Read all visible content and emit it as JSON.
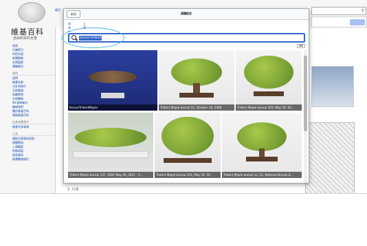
{
  "background": {
    "logo_title": "維基百科",
    "logo_subtitle": "自由的百科全書",
    "top_tab_label": "條目",
    "sidebar": [
      {
        "heading": "",
        "links": [
          "首頁",
          "分類索引",
          "特色內容",
          "新聞動態",
          "近期變更",
          "隨機條目"
        ]
      },
      {
        "heading": "說明",
        "links": [
          "說明",
          "維基社群",
          "方針與指引",
          "互助客棧",
          "知識問答",
          "字詞轉換",
          "IRC即時聊天",
          "聯絡我們",
          "關於維基百科",
          "資助維基百科"
        ]
      },
      {
        "heading": "在其他專案中",
        "links": [
          "維基共享資源"
        ]
      },
      {
        "heading": "工具",
        "links": [
          "連結至頁面的頁面",
          "相關更改",
          "上傳檔案",
          "特殊頁面",
          "頁面資訊",
          "維基數據項目"
        ]
      }
    ],
    "section_text": "2. 川派"
  },
  "dialog": {
    "cancel_label": "取消",
    "title": "媒體設定",
    "tabs": [
      "搜尋",
      "上傳"
    ],
    "search_value": "bonsai trident",
    "results": [
      {
        "caption": "BonsaiTridentMaple"
      },
      {
        "caption": "Trident Maple bonsai 52, October 10, 2008"
      },
      {
        "caption": "Trident Maple bonsai 203, May 29, 20..."
      },
      {
        "caption": "Trident Maple bonsai 137, 2001 May 29, 2011 - S..."
      },
      {
        "caption": "Trident Maple bonsai 203, May 29, 20..."
      },
      {
        "caption": "Trident Maple bonsai no. 52, National Bonsai &..."
      }
    ]
  },
  "icons": {
    "search": "search-icon",
    "language": "language-icon"
  },
  "colors": {
    "accent": "#3366cc",
    "highlight_ring": "#4fb6e2"
  }
}
